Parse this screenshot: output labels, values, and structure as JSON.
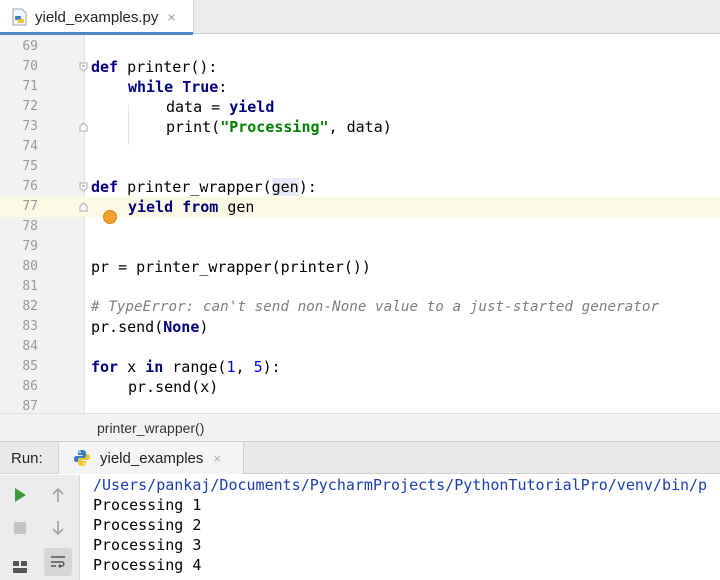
{
  "tab": {
    "filename": "yield_examples.py",
    "close": "×"
  },
  "editor": {
    "line_numbers": [
      "69",
      "70",
      "71",
      "72",
      "73",
      "74",
      "75",
      "76",
      "77",
      "78",
      "79",
      "80",
      "81",
      "82",
      "83",
      "84",
      "85",
      "86",
      "87"
    ],
    "code": {
      "l70_kw": "def",
      "l70_rest": " printer():",
      "l71_kw": "while",
      "l71_kw2": "True",
      "l71_rest": ":",
      "l72_a": "data = ",
      "l72_kw": "yield",
      "l73_a": "print(",
      "l73_str": "\"Processing\"",
      "l73_b": ", data)",
      "l76_kw": "def",
      "l76_a": " printer_wrapper(",
      "l76_param": "gen",
      "l76_b": "):",
      "l77_kw": "yield from",
      "l77_rest": " gen",
      "l80": "pr = printer_wrapper(printer())",
      "l82_comment": "# TypeError: can't send non-None value to a just-started generator",
      "l83_a": "pr.send(",
      "l83_kw": "None",
      "l83_b": ")",
      "l85_kw": "for",
      "l85_a": " x ",
      "l85_kw2": "in",
      "l85_b": " range(",
      "l85_n1": "1",
      "l85_c": ", ",
      "l85_n2": "5",
      "l85_d": "):",
      "l86": "pr.send(x)"
    }
  },
  "breadcrumb": {
    "current": "printer_wrapper()"
  },
  "run": {
    "label": "Run:",
    "tab_label": "yield_examples",
    "tab_close": "×",
    "console": [
      "/Users/pankaj/Documents/PycharmProjects/PythonTutorialPro/venv/bin/p",
      "Processing 1",
      "Processing 2",
      "Processing 3",
      "Processing 4"
    ]
  },
  "colors": {
    "keyword": "#000080",
    "string": "#008000",
    "number": "#0000ff",
    "comment": "#808080",
    "console_path": "#1a3db4",
    "run_green": "#3e9a3e",
    "current_line": "#fcfae4"
  },
  "icons": {
    "file": "python-file-icon",
    "bulb": "intention-bulb-icon",
    "run": "play-icon",
    "stop": "stop-icon",
    "up": "arrow-up-icon",
    "down": "arrow-down-icon",
    "wrap": "soft-wrap-icon",
    "layout": "layout-icon"
  }
}
